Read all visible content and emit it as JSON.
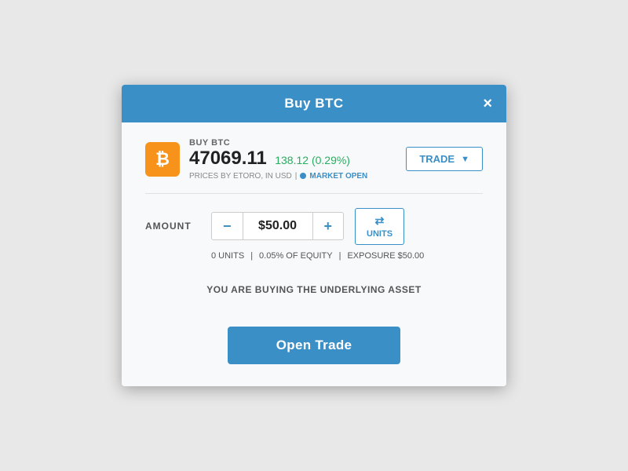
{
  "modal": {
    "title": "Buy BTC",
    "close_label": "×"
  },
  "asset": {
    "label": "BUY BTC",
    "icon_symbol": "₿",
    "price": "47069.11",
    "change": "138.12 (0.29%)",
    "meta": "PRICES BY ETORO, IN USD",
    "market_status": "MARKET OPEN"
  },
  "trade_dropdown": {
    "label": "TRADE",
    "arrow": "▼"
  },
  "amount_section": {
    "label": "AMOUNT",
    "minus_label": "−",
    "value": "$50.00",
    "plus_label": "+",
    "units_label": "UNITS",
    "units_icon": "⇄",
    "units_count": "0 UNITS",
    "equity_pct": "0.05% OF EQUITY",
    "exposure": "EXPOSURE $50.00"
  },
  "message": {
    "text": "YOU ARE BUYING THE UNDERLYING ASSET"
  },
  "open_trade_btn": {
    "label": "Open Trade"
  }
}
